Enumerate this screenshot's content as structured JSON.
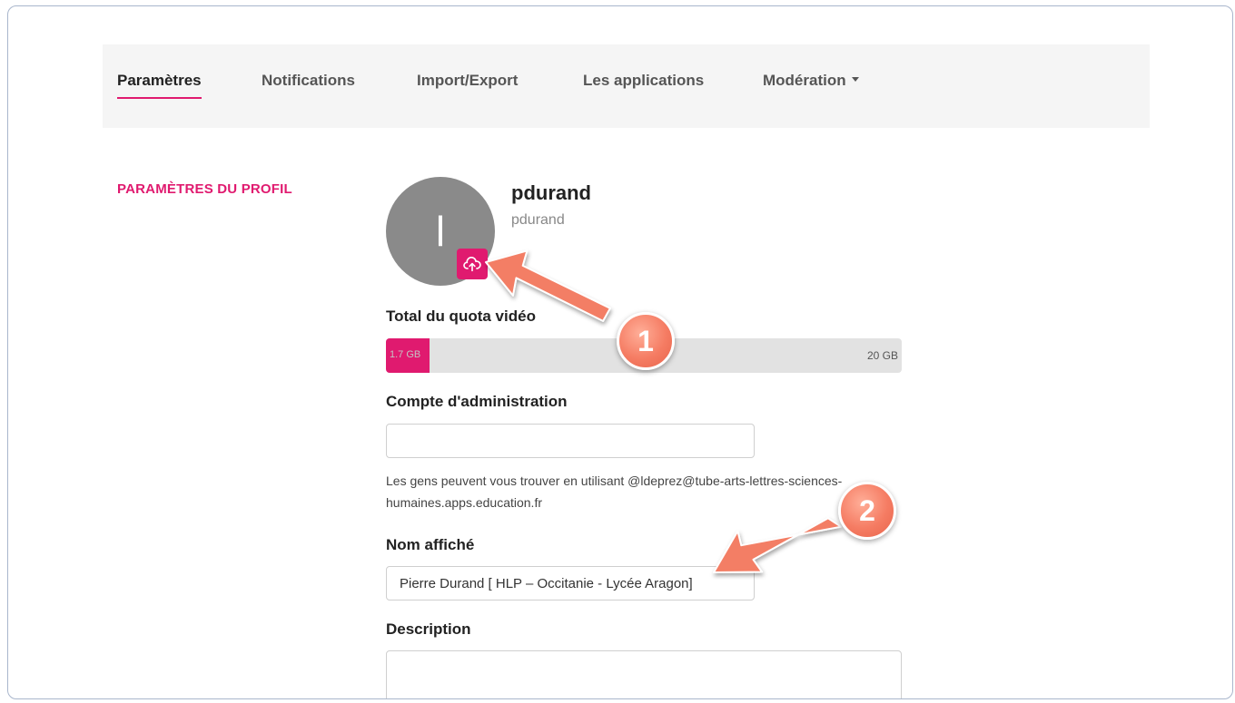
{
  "nav": {
    "tabs": [
      {
        "label": "Paramètres",
        "active": true
      },
      {
        "label": "Notifications"
      },
      {
        "label": "Import/Export"
      },
      {
        "label": "Les applications"
      },
      {
        "label": "Modération"
      }
    ]
  },
  "profile_section": {
    "title": "PARAMÈTRES DU PROFIL",
    "avatar_letter": "l",
    "display_username": "pdurand",
    "handle": "pdurand",
    "upload_icon": "cloud-upload-icon"
  },
  "quota": {
    "label": "Total du quota vidéo",
    "used": "1.7 GB",
    "total": "20 GB",
    "fraction_used": 0.085
  },
  "admin_account": {
    "label": "Compte d'administration",
    "value": "",
    "help": "Les gens peuvent vous trouver en utilisant @ldeprez@tube-arts-lettres-sciences-humaines.apps.education.fr"
  },
  "display_name": {
    "label": "Nom affiché",
    "value": "Pierre Durand [ HLP – Occitanie - Lycée Aragon]"
  },
  "description": {
    "label": "Description",
    "value": ""
  },
  "callouts": [
    "1",
    "2"
  ],
  "colors": {
    "accent": "#e01a6f",
    "callout": "#f57c63",
    "tabs_background": "#f5f5f5",
    "quota_track": "#e2e2e2"
  }
}
